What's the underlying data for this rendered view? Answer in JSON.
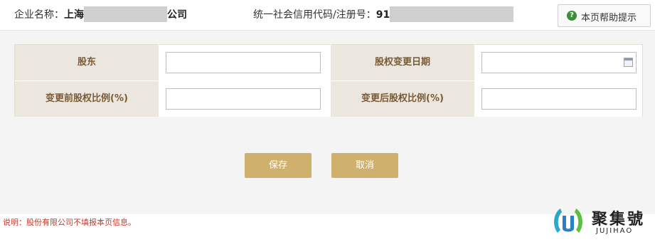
{
  "header": {
    "company_label": "企业名称：",
    "company_prefix": "上海",
    "company_suffix": "公司",
    "credit_label": "统一社会信用代码/注册号：",
    "credit_prefix": "91",
    "help_button": "本页帮助提示",
    "help_icon": "question-circle-icon"
  },
  "form": {
    "shareholder_label": "股东",
    "shareholder_value": "",
    "change_date_label": "股权变更日期",
    "change_date_value": "",
    "before_ratio_label": "变更前股权比例(%)",
    "before_ratio_value": "",
    "after_ratio_label": "变更后股权比例(%)",
    "after_ratio_value": ""
  },
  "actions": {
    "save": "保存",
    "cancel": "取消"
  },
  "note": "说明：股份有限公司不填报本页信息。",
  "watermark": {
    "name": "聚集號",
    "pinyin": "JUJIHAO"
  },
  "colors": {
    "label_bg": "#ebe6de",
    "label_text": "#7a5a33",
    "button_bg": "#d0b06d",
    "note_text": "#c0392b",
    "help_icon": "#3c8f3c"
  }
}
